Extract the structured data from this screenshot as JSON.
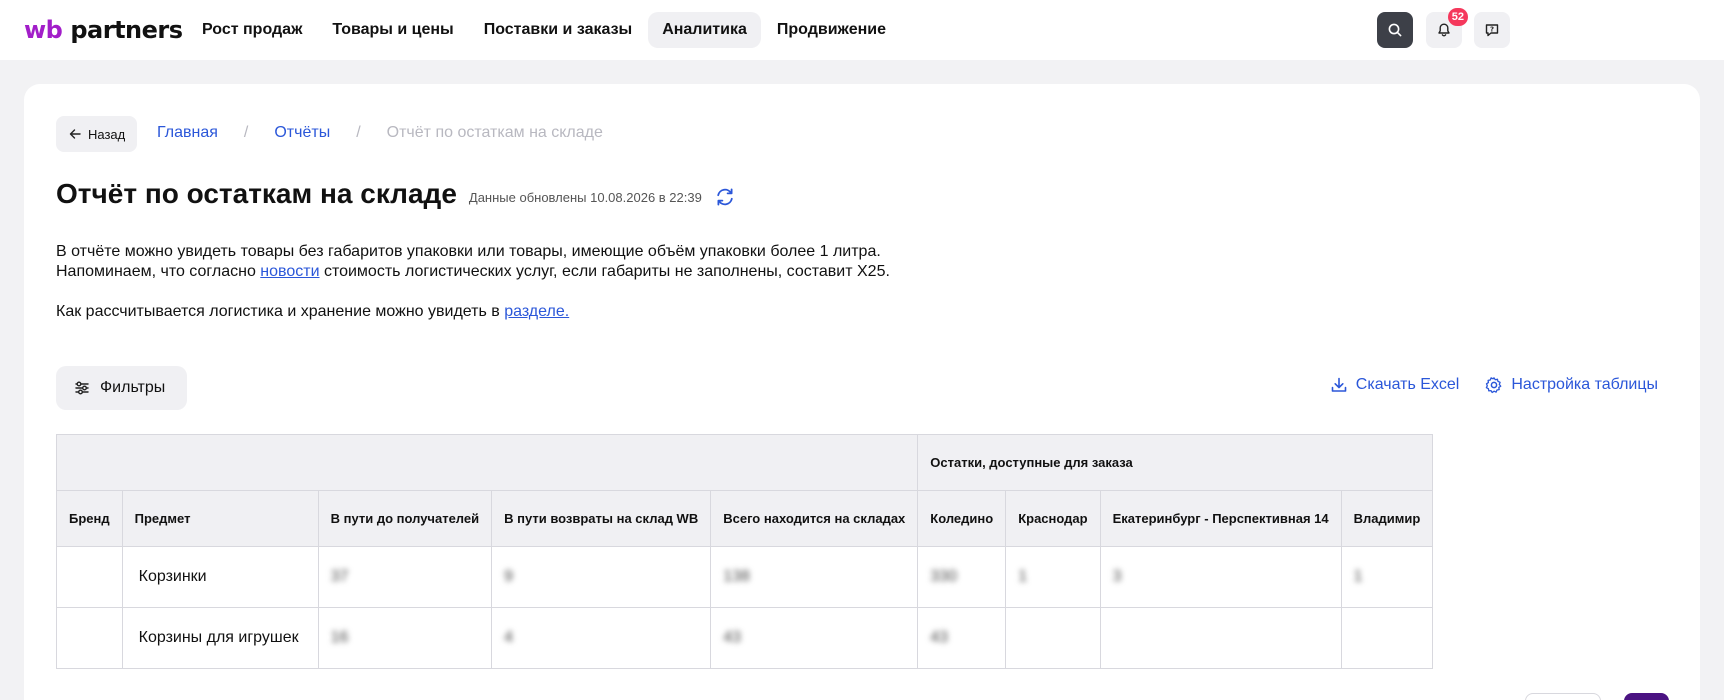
{
  "header": {
    "logo_wb": "wb",
    "logo_partners": "partners",
    "nav": [
      "Рост продаж",
      "Товары и цены",
      "Поставки и заказы",
      "Аналитика",
      "Продвижение"
    ],
    "active_nav_index": 3,
    "notifications_count": "52",
    "icons": [
      "search-icon",
      "bell-icon",
      "chat-icon"
    ]
  },
  "breadcrumbs": {
    "back_label": "Назад",
    "home": "Главная",
    "reports": "Отчёты",
    "current": "Отчёт по остаткам на складе",
    "separator": "/"
  },
  "page": {
    "title": "Отчёт по остаткам на складе",
    "updated": "Данные обновлены 10.08.2026 в 22:39"
  },
  "info": {
    "line1": "В отчёте можно увидеть товары без габаритов упаковки или товары, имеющие объём упаковки более 1 литра.",
    "line2_before": "Напоминаем, что согласно ",
    "line2_link": "новости",
    "line2_after": " стоимость логистических услуг, если габариты не заполнены, составит X25.",
    "line3_before": "Как рассчитывается логистика и хранение можно увидеть в ",
    "line3_link": "разделе."
  },
  "toolbar": {
    "filters_label": "Фильтры",
    "download_label": "Скачать Excel",
    "settings_label": "Настройка таблицы"
  },
  "table": {
    "group_header": "Остатки, доступные для заказа",
    "columns": [
      "Бренд",
      "Предмет",
      "В пути до получателей",
      "В пути возвраты на склад WB",
      "Всего находится на складах",
      "Коледино",
      "Краснодар",
      "Екатеринбург - Перспективная 14",
      "Владимир"
    ],
    "rows": [
      [
        "",
        "Корзинки",
        "37",
        "9",
        "138",
        "330",
        "1",
        "3",
        "1"
      ],
      [
        "",
        "Корзины для игрушек",
        "16",
        "4",
        "43",
        "43",
        "",
        "",
        ""
      ]
    ]
  },
  "colors": {
    "accent_link": "#2b57d9",
    "brand_purple": "#a21ec9",
    "badge_red": "#f5385c",
    "pager_active": "#4b1382"
  }
}
